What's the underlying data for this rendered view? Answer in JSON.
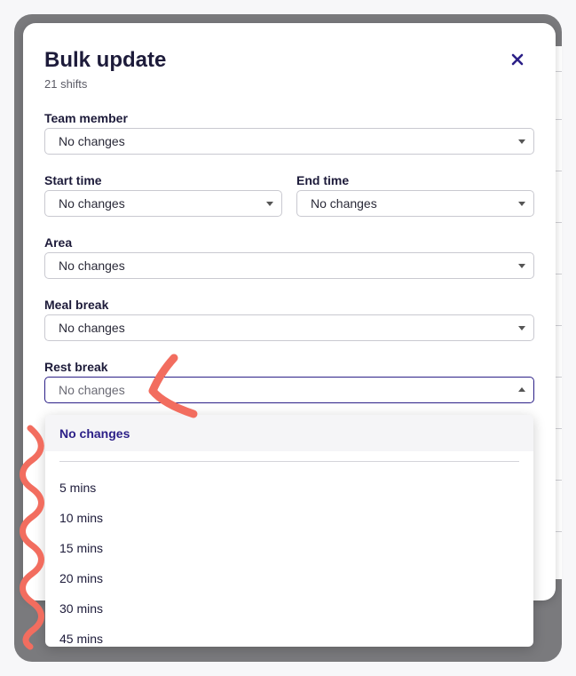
{
  "modal": {
    "title": "Bulk update",
    "subtitle": "21 shifts",
    "close_icon": "close-icon"
  },
  "fields": {
    "team_member": {
      "label": "Team member",
      "value": "No changes"
    },
    "start_time": {
      "label": "Start time",
      "value": "No changes"
    },
    "end_time": {
      "label": "End time",
      "value": "No changes"
    },
    "area": {
      "label": "Area",
      "value": "No changes"
    },
    "meal_break": {
      "label": "Meal break",
      "value": "No changes"
    },
    "rest_break": {
      "label": "Rest break",
      "value": "No changes"
    }
  },
  "dropdown": {
    "selected": "No changes",
    "options": [
      "5 mins",
      "10 mins",
      "15 mins",
      "20 mins",
      "30 mins",
      "45 mins"
    ]
  },
  "colors": {
    "accent": "#2b1f87",
    "annotation": "#f26d5f",
    "overlay": "#7a7a7d"
  }
}
